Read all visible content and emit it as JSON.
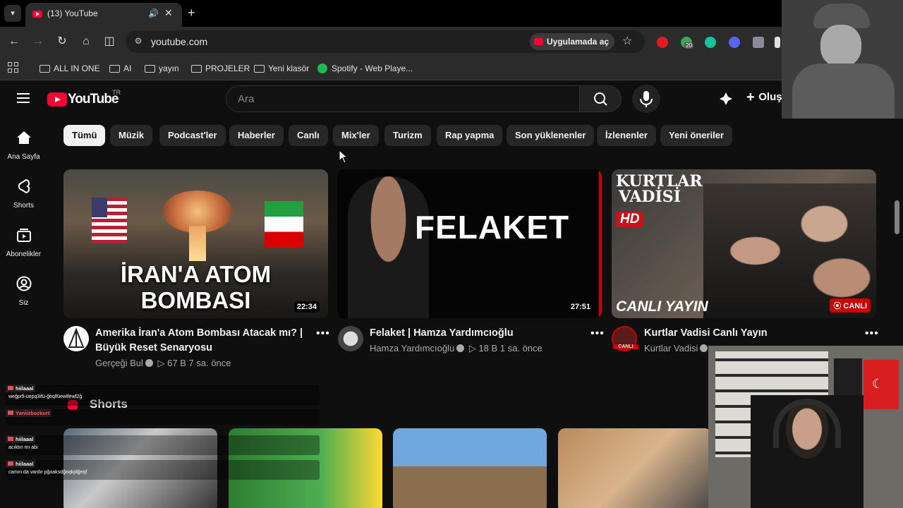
{
  "browser": {
    "tab_title": "(13) YouTube",
    "url": "youtube.com",
    "open_in_app": "Uygulamada aç",
    "extension_badge": "20",
    "bookmarks": [
      "ALL IN ONE",
      "AI",
      "yayın",
      "PROJELER",
      "Yeni klasör",
      "Spotify - Web Playe..."
    ]
  },
  "youtube": {
    "logo_text": "YouTube",
    "logo_country": "TR",
    "search_placeholder": "Ara",
    "create_label": "Oluş",
    "sidebar": [
      {
        "label": "Ana Sayfa",
        "icon": "home-icon"
      },
      {
        "label": "Shorts",
        "icon": "shorts-icon"
      },
      {
        "label": "Abonelikler",
        "icon": "subscriptions-icon"
      },
      {
        "label": "Siz",
        "icon": "you-icon"
      }
    ],
    "chips": [
      "Tümü",
      "Müzik",
      "Podcast'ler",
      "Haberler",
      "Canlı",
      "Mix'ler",
      "Turizm",
      "Rap yapma",
      "Son yüklenenler",
      "İzlenenler",
      "Yeni öneriler"
    ],
    "videos": [
      {
        "thumb_text_line1": "İRAN'A ATOM",
        "thumb_text_line2": "BOMBASI",
        "duration": "22:34",
        "title": "Amerika İran'a Atom Bombası Atacak mı? | Büyük Reset Senaryosu",
        "channel": "Gerçeği Bul",
        "views": "▷ 67 B",
        "age": "7 sa. önce"
      },
      {
        "thumb_text_line1": "FELAKET",
        "duration": "27:51",
        "title": "Felaket | Hamza Yardımcıoğlu",
        "channel": "Hamza Yardımcıoğlu",
        "views": "▷ 18 B",
        "age": "1 sa. önce"
      },
      {
        "thumb_text_line1": "KURTLAR",
        "thumb_text_line2": "VADİSİ",
        "thumb_hd": "HD",
        "thumb_live_text": "CANLI YAYIN",
        "live_badge": "CANLI",
        "avatar_badge": "CANLI",
        "title": "Kurtlar Vadisi Canlı Yayın",
        "channel": "Kurtlar Vadisi"
      }
    ],
    "shorts_heading": "Shorts"
  },
  "chat": [
    {
      "user": "hiilaaal",
      "message": "weğprfi-üepq3ifü-ğeqlfüewlfewf2ğ"
    },
    {
      "user": "Yaniizbozkurt",
      "message": ""
    },
    {
      "user": "hiilaaal",
      "message": "acıktın mı abi"
    },
    {
      "user": "hiilaaal",
      "message": "camın da vardır pğoaksdğoqkjdğeqf"
    }
  ]
}
